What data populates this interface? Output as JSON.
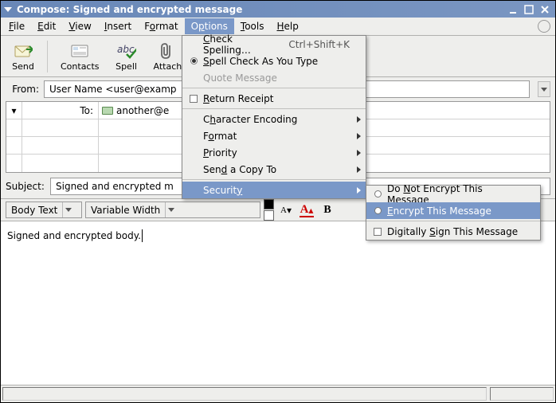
{
  "title": "Compose: Signed and encrypted message",
  "menubar": {
    "file": "File",
    "edit": "Edit",
    "view": "View",
    "insert": "Insert",
    "format": "Format",
    "options": "Options",
    "tools": "Tools",
    "help": "Help"
  },
  "toolbar": {
    "send": "Send",
    "contacts": "Contacts",
    "spell": "Spell",
    "attach": "Attach"
  },
  "from": {
    "label": "From:",
    "value": "User Name <user@examp"
  },
  "recipients": [
    {
      "type": "To:",
      "icon_head": "▾",
      "addr": "another@e"
    },
    {
      "type": "",
      "addr": ""
    },
    {
      "type": "",
      "addr": ""
    },
    {
      "type": "",
      "addr": ""
    }
  ],
  "subject": {
    "label": "Subject:",
    "value": "Signed and encrypted m"
  },
  "fmt": {
    "para": "Body Text",
    "font": "Variable Width"
  },
  "body_text": "Signed and encrypted body.",
  "options_menu": {
    "check_spelling": "Check Spelling…",
    "check_spelling_accel": "Ctrl+Shift+K",
    "spell_as_type": "Spell Check As You Type",
    "quote": "Quote Message",
    "return_receipt": "Return Receipt",
    "char_encoding": "Character Encoding",
    "format": "Format",
    "priority": "Priority",
    "send_copy": "Send a Copy To",
    "security": "Security"
  },
  "security_menu": {
    "no_encrypt": "Do Not Encrypt This Message",
    "encrypt": "Encrypt This Message",
    "sign": "Digitally Sign This Message"
  }
}
